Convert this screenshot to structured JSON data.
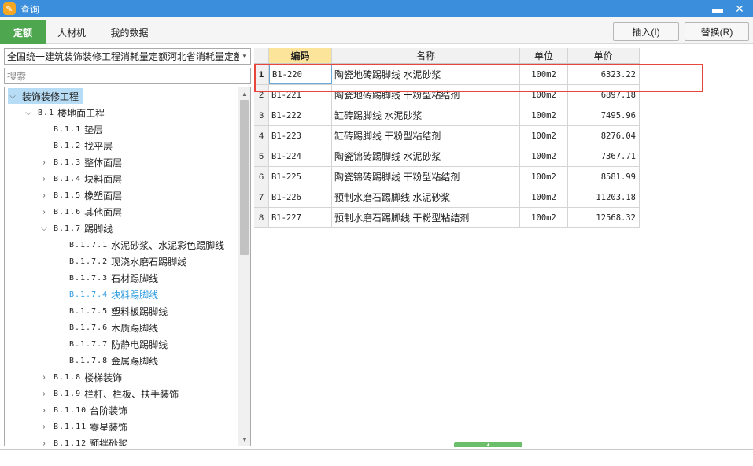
{
  "window": {
    "title": "查询",
    "minimize_glyph": "▬",
    "close_glyph": "✕",
    "icon": "app-logo-icon"
  },
  "tabs": [
    {
      "label": "定额",
      "active": true
    },
    {
      "label": "人材机",
      "active": false
    },
    {
      "label": "我的数据",
      "active": false
    }
  ],
  "actions": {
    "insert_label": "插入(I)",
    "replace_label": "替换(R)"
  },
  "left": {
    "quota_library": "全国统一建筑装饰装修工程消耗量定额河北省消耗量定额",
    "search_placeholder": "搜索",
    "tree": [
      {
        "code": "",
        "label": "装饰装修工程",
        "level": 0,
        "arrow": "expanded",
        "state": "selected"
      },
      {
        "code": "B.1",
        "label": "楼地面工程",
        "level": 1,
        "arrow": "expanded",
        "state": ""
      },
      {
        "code": "B.1.1",
        "label": "垫层",
        "level": 2,
        "arrow": "none",
        "state": ""
      },
      {
        "code": "B.1.2",
        "label": "找平层",
        "level": 2,
        "arrow": "none",
        "state": ""
      },
      {
        "code": "B.1.3",
        "label": "整体面层",
        "level": 2,
        "arrow": "collapsed",
        "state": ""
      },
      {
        "code": "B.1.4",
        "label": "块料面层",
        "level": 2,
        "arrow": "collapsed",
        "state": ""
      },
      {
        "code": "B.1.5",
        "label": "橡塑面层",
        "level": 2,
        "arrow": "collapsed",
        "state": ""
      },
      {
        "code": "B.1.6",
        "label": "其他面层",
        "level": 2,
        "arrow": "collapsed",
        "state": ""
      },
      {
        "code": "B.1.7",
        "label": "踢脚线",
        "level": 2,
        "arrow": "expanded",
        "state": ""
      },
      {
        "code": "B.1.7.1",
        "label": "水泥砂浆、水泥彩色踢脚线",
        "level": 3,
        "arrow": "none",
        "state": ""
      },
      {
        "code": "B.1.7.2",
        "label": "现浇水磨石踢脚线",
        "level": 3,
        "arrow": "none",
        "state": ""
      },
      {
        "code": "B.1.7.3",
        "label": "石材踢脚线",
        "level": 3,
        "arrow": "none",
        "state": ""
      },
      {
        "code": "B.1.7.4",
        "label": "块料踢脚线",
        "level": 3,
        "arrow": "none",
        "state": "current"
      },
      {
        "code": "B.1.7.5",
        "label": "塑料板踢脚线",
        "level": 3,
        "arrow": "none",
        "state": ""
      },
      {
        "code": "B.1.7.6",
        "label": "木质踢脚线",
        "level": 3,
        "arrow": "none",
        "state": ""
      },
      {
        "code": "B.1.7.7",
        "label": "防静电踢脚线",
        "level": 3,
        "arrow": "none",
        "state": ""
      },
      {
        "code": "B.1.7.8",
        "label": "金属踢脚线",
        "level": 3,
        "arrow": "none",
        "state": ""
      },
      {
        "code": "B.1.8",
        "label": "楼梯装饰",
        "level": 2,
        "arrow": "collapsed",
        "state": ""
      },
      {
        "code": "B.1.9",
        "label": "栏杆、栏板、扶手装饰",
        "level": 2,
        "arrow": "collapsed",
        "state": ""
      },
      {
        "code": "B.1.10",
        "label": "台阶装饰",
        "level": 2,
        "arrow": "collapsed",
        "state": ""
      },
      {
        "code": "B.1.11",
        "label": "零星装饰",
        "level": 2,
        "arrow": "collapsed",
        "state": ""
      },
      {
        "code": "B.1.12",
        "label": "预拌砂浆",
        "level": 2,
        "arrow": "collapsed",
        "state": ""
      }
    ]
  },
  "grid": {
    "columns": [
      "",
      "编码",
      "名称",
      "单位",
      "单价"
    ],
    "rows": [
      {
        "idx": "1",
        "code": "B1-220",
        "name": "陶瓷地砖踢脚线 水泥砂浆",
        "unit": "100m2",
        "price": "6323.22"
      },
      {
        "idx": "2",
        "code": "B1-221",
        "name": "陶瓷地砖踢脚线 干粉型粘结剂",
        "unit": "100m2",
        "price": "6897.18"
      },
      {
        "idx": "3",
        "code": "B1-222",
        "name": "缸砖踢脚线 水泥砂浆",
        "unit": "100m2",
        "price": "7495.96"
      },
      {
        "idx": "4",
        "code": "B1-223",
        "name": "缸砖踢脚线 干粉型粘结剂",
        "unit": "100m2",
        "price": "8276.04"
      },
      {
        "idx": "5",
        "code": "B1-224",
        "name": "陶瓷锦砖踢脚线 水泥砂浆",
        "unit": "100m2",
        "price": "7367.71"
      },
      {
        "idx": "6",
        "code": "B1-225",
        "name": "陶瓷锦砖踢脚线 干粉型粘结剂",
        "unit": "100m2",
        "price": "8581.99"
      },
      {
        "idx": "7",
        "code": "B1-226",
        "name": "预制水磨石踢脚线 水泥砂浆",
        "unit": "100m2",
        "price": "11203.18"
      },
      {
        "idx": "8",
        "code": "B1-227",
        "name": "预制水磨石踢脚线 干粉型粘结剂",
        "unit": "100m2",
        "price": "12568.32"
      }
    ]
  },
  "colors": {
    "titlebar": "#3a8edb",
    "active_tab": "#4ea74e",
    "highlight": "#e8453c",
    "current_node": "#2b9ae0"
  }
}
